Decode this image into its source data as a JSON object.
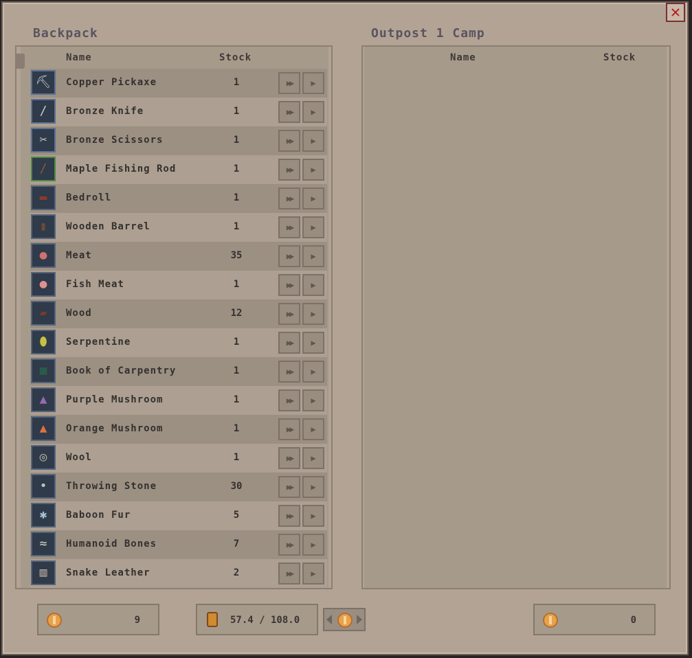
{
  "close_label": "✕",
  "backpack": {
    "title": "Backpack",
    "col_name": "Name",
    "col_stock": "Stock",
    "items": [
      {
        "name": "Copper Pickaxe",
        "stock": "1",
        "icon": "pickaxe-icon",
        "glyph": "⛏",
        "color": "#c9c9c9"
      },
      {
        "name": "Bronze Knife",
        "stock": "1",
        "icon": "knife-icon",
        "glyph": "/",
        "color": "#c9c9c9"
      },
      {
        "name": "Bronze Scissors",
        "stock": "1",
        "icon": "scissors-icon",
        "glyph": "✂",
        "color": "#c9c9c9"
      },
      {
        "name": "Maple Fishing Rod",
        "stock": "1",
        "icon": "fishing-rod-icon",
        "glyph": "/",
        "color": "#8a5a3a"
      },
      {
        "name": "Bedroll",
        "stock": "1",
        "icon": "bedroll-icon",
        "glyph": "▬",
        "color": "#8a3a2a"
      },
      {
        "name": "Wooden Barrel",
        "stock": "1",
        "icon": "barrel-icon",
        "glyph": "▮",
        "color": "#6a4a3a"
      },
      {
        "name": "Meat",
        "stock": "35",
        "icon": "meat-icon",
        "glyph": "●",
        "color": "#d07070"
      },
      {
        "name": "Fish Meat",
        "stock": "1",
        "icon": "fish-meat-icon",
        "glyph": "●",
        "color": "#e09090"
      },
      {
        "name": "Wood",
        "stock": "12",
        "icon": "wood-icon",
        "glyph": "▰",
        "color": "#7a3a2a"
      },
      {
        "name": "Serpentine",
        "stock": "1",
        "icon": "gem-icon",
        "glyph": "⬮",
        "color": "#c8c040"
      },
      {
        "name": "Book of Carpentry",
        "stock": "1",
        "icon": "book-icon",
        "glyph": "■",
        "color": "#2a5a4a"
      },
      {
        "name": "Purple Mushroom",
        "stock": "1",
        "icon": "purple-mushroom-icon",
        "glyph": "▲",
        "color": "#9a6ab0"
      },
      {
        "name": "Orange Mushroom",
        "stock": "1",
        "icon": "orange-mushroom-icon",
        "glyph": "▲",
        "color": "#e07040"
      },
      {
        "name": "Wool",
        "stock": "1",
        "icon": "wool-icon",
        "glyph": "◎",
        "color": "#b8b8a8"
      },
      {
        "name": "Throwing Stone",
        "stock": "30",
        "icon": "stone-icon",
        "glyph": "•",
        "color": "#c8c0b8"
      },
      {
        "name": "Baboon Fur",
        "stock": "5",
        "icon": "fur-icon",
        "glyph": "✱",
        "color": "#a8c0d0"
      },
      {
        "name": "Humanoid Bones",
        "stock": "7",
        "icon": "bones-icon",
        "glyph": "≈",
        "color": "#d8d0c0"
      },
      {
        "name": "Snake Leather",
        "stock": "2",
        "icon": "leather-icon",
        "glyph": "▥",
        "color": "#c0b0a0"
      }
    ]
  },
  "camp": {
    "title": "Outpost 1 Camp",
    "col_name": "Name",
    "col_stock": "Stock"
  },
  "footer": {
    "player_coins": "9",
    "weight": "57.4 / 108.0",
    "camp_coins": "0"
  }
}
